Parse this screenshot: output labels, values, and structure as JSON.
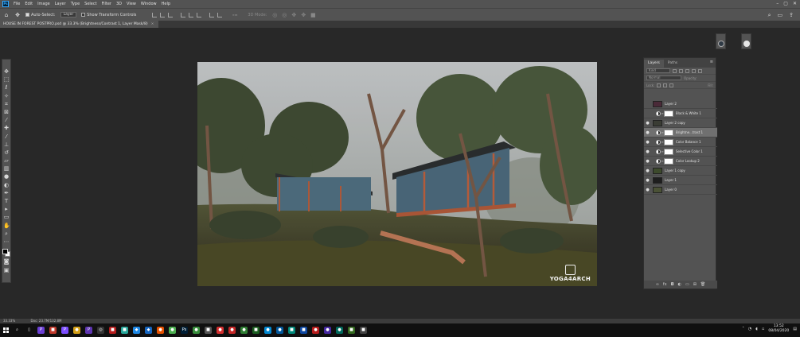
{
  "menubar": {
    "logo": "Ps",
    "items": [
      "File",
      "Edit",
      "Image",
      "Layer",
      "Type",
      "Select",
      "Filter",
      "3D",
      "View",
      "Window",
      "Help"
    ]
  },
  "options": {
    "auto_select_label": "Auto-Select:",
    "auto_select_target": "Layer",
    "transform_controls_label": "Show Transform Controls",
    "mode_3d_label": "3D Mode:"
  },
  "document": {
    "tab_title": "HOUSE IN FOREST POSTPRO.psd @ 33.3% (Brightness/Contrast 1, Layer Mask/8)",
    "watermark": "YOGA4ARCH"
  },
  "layers_panel": {
    "tabs": [
      "Layers",
      "Paths"
    ],
    "active_tab": "Layers",
    "filter_placeholder": "Kind",
    "blend_mode": "Normal",
    "opacity_label": "Opacity:",
    "lock_label": "Lock:",
    "fill_label": "Fill:",
    "layers": [
      {
        "name": "Layer 2",
        "visible": false,
        "type": "pixel",
        "selected": false,
        "thumb": "#4a2a38"
      },
      {
        "name": "Black & White 1",
        "visible": false,
        "type": "adjust",
        "selected": false
      },
      {
        "name": "Layer 2 copy",
        "visible": true,
        "type": "pixel",
        "selected": false,
        "thumb": "#3a3c34"
      },
      {
        "name": "Brightne...trast 1",
        "visible": true,
        "type": "adjust",
        "selected": true
      },
      {
        "name": "Color Balance 1",
        "visible": true,
        "type": "adjust",
        "selected": false
      },
      {
        "name": "Selective Color 1",
        "visible": true,
        "type": "adjust",
        "selected": false
      },
      {
        "name": "Color Lookup 2",
        "visible": true,
        "type": "adjust",
        "selected": false
      },
      {
        "name": "Layer 1 copy",
        "visible": true,
        "type": "pixel",
        "selected": false,
        "thumb": "#3d4a2c"
      },
      {
        "name": "Layer 1",
        "visible": true,
        "type": "pixel",
        "selected": false,
        "thumb": "#1e1e1e"
      },
      {
        "name": "Layer 0",
        "visible": true,
        "type": "pixel",
        "selected": false,
        "thumb": "#4b5236"
      }
    ]
  },
  "status": {
    "zoom": "33.33%",
    "doc_size": "Doc: 23.7M/132.8M"
  },
  "taskbar": {
    "time": "13:52",
    "date": "08/04/2020",
    "apps": [
      {
        "name": "search-icon",
        "glyph": "⌕",
        "color": "#101010"
      },
      {
        "name": "task-view-icon",
        "glyph": "▯",
        "color": "#101010"
      },
      {
        "name": "app-purple-1",
        "glyph": "P",
        "color": "#6b3fd4"
      },
      {
        "name": "app-red",
        "glyph": "■",
        "color": "#c0392b"
      },
      {
        "name": "app-purple-2",
        "glyph": "P",
        "color": "#7c4dff"
      },
      {
        "name": "app-yellow",
        "glyph": "●",
        "color": "#d4a017"
      },
      {
        "name": "app-purple-3",
        "glyph": "P",
        "color": "#5e35b1"
      },
      {
        "name": "app-dark",
        "glyph": "◎",
        "color": "#333"
      },
      {
        "name": "app-red-2",
        "glyph": "■",
        "color": "#b71c1c"
      },
      {
        "name": "app-teal",
        "glyph": "■",
        "color": "#26a69a"
      },
      {
        "name": "app-blue",
        "glyph": "◆",
        "color": "#1e88e5"
      },
      {
        "name": "app-blue-2",
        "glyph": "◆",
        "color": "#1565c0"
      },
      {
        "name": "app-orange",
        "glyph": "●",
        "color": "#e65100"
      },
      {
        "name": "app-chrome",
        "glyph": "●",
        "color": "#4caf50"
      },
      {
        "name": "app-photoshop",
        "glyph": "Ps",
        "color": "#001e36"
      },
      {
        "name": "app-green",
        "glyph": "●",
        "color": "#388e3c"
      },
      {
        "name": "app-gray",
        "glyph": "■",
        "color": "#555"
      },
      {
        "name": "app-red-3",
        "glyph": "●",
        "color": "#d32f2f"
      },
      {
        "name": "app-red-4",
        "glyph": "●",
        "color": "#c62828"
      },
      {
        "name": "app-green-2",
        "glyph": "●",
        "color": "#2e7d32"
      },
      {
        "name": "app-green-3",
        "glyph": "■",
        "color": "#1b5e20"
      },
      {
        "name": "app-blue-3",
        "glyph": "●",
        "color": "#0288d1"
      },
      {
        "name": "app-blue-4",
        "glyph": "●",
        "color": "#01579b"
      },
      {
        "name": "app-teal-2",
        "glyph": "■",
        "color": "#00897b"
      },
      {
        "name": "app-blue-5",
        "glyph": "■",
        "color": "#0d47a1"
      },
      {
        "name": "app-red-5",
        "glyph": "●",
        "color": "#b71c1c"
      },
      {
        "name": "app-purple-4",
        "glyph": "●",
        "color": "#4527a0"
      },
      {
        "name": "app-teal-3",
        "glyph": "●",
        "color": "#00695c"
      },
      {
        "name": "app-green-4",
        "glyph": "■",
        "color": "#33691e"
      },
      {
        "name": "app-gray-2",
        "glyph": "■",
        "color": "#424242"
      }
    ]
  }
}
